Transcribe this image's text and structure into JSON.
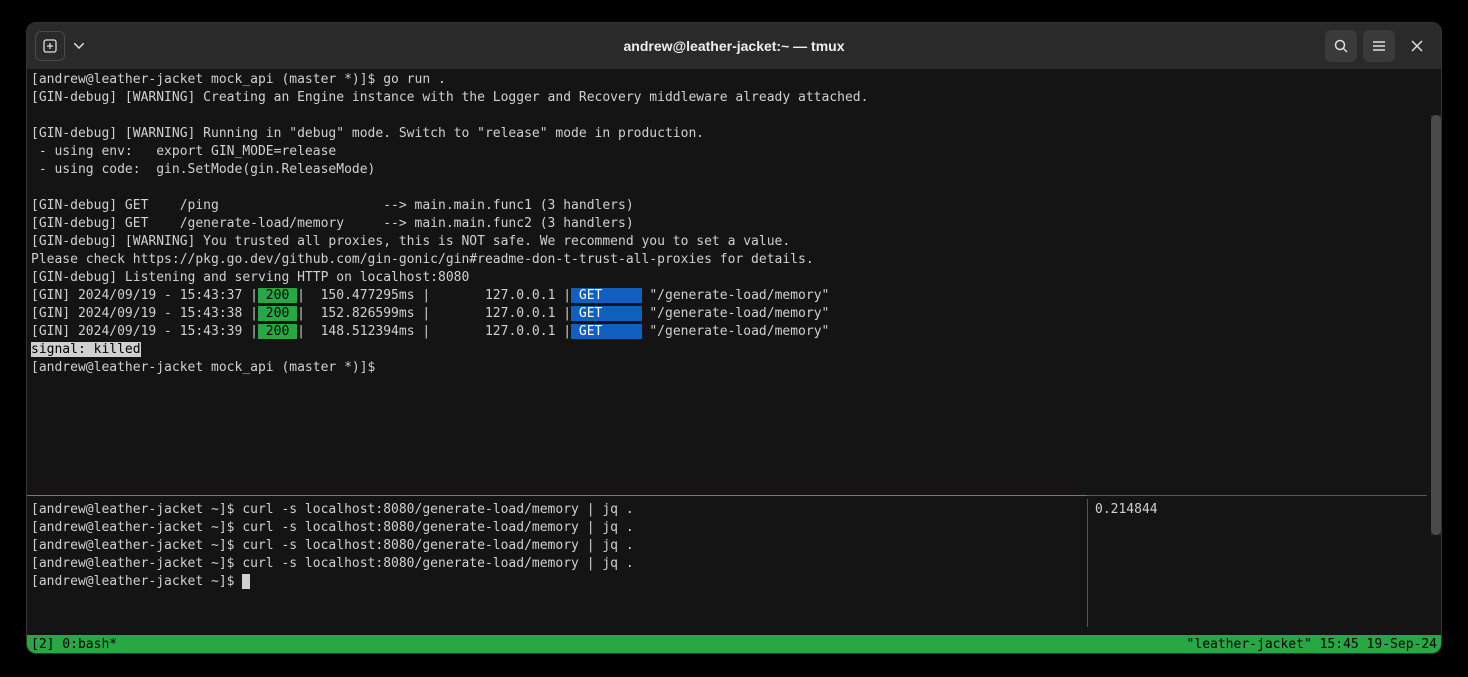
{
  "titlebar": {
    "title": "andrew@leather-jacket:~ — tmux"
  },
  "pane_top": {
    "lines": [
      "[andrew@leather-jacket mock_api (master *)]$ go run .",
      "[GIN-debug] [WARNING] Creating an Engine instance with the Logger and Recovery middleware already attached.",
      "",
      "[GIN-debug] [WARNING] Running in \"debug\" mode. Switch to \"release\" mode in production.",
      " - using env:   export GIN_MODE=release",
      " - using code:  gin.SetMode(gin.ReleaseMode)",
      "",
      "[GIN-debug] GET    /ping                     --> main.main.func1 (3 handlers)",
      "[GIN-debug] GET    /generate-load/memory     --> main.main.func2 (3 handlers)",
      "[GIN-debug] [WARNING] You trusted all proxies, this is NOT safe. We recommend you to set a value.",
      "Please check https://pkg.go.dev/github.com/gin-gonic/gin#readme-don-t-trust-all-proxies for details.",
      "[GIN-debug] Listening and serving HTTP on localhost:8080"
    ],
    "requests": [
      {
        "prefix": "[GIN] 2024/09/19 - 15:43:37 |",
        "status": " 200 ",
        "mid": "|  150.477295ms |       127.0.0.1 |",
        "method": " GET     ",
        "path": " \"/generate-load/memory\""
      },
      {
        "prefix": "[GIN] 2024/09/19 - 15:43:38 |",
        "status": " 200 ",
        "mid": "|  152.826599ms |       127.0.0.1 |",
        "method": " GET     ",
        "path": " \"/generate-load/memory\""
      },
      {
        "prefix": "[GIN] 2024/09/19 - 15:43:39 |",
        "status": " 200 ",
        "mid": "|  148.512394ms |       127.0.0.1 |",
        "method": " GET     ",
        "path": " \"/generate-load/memory\""
      }
    ],
    "signal": "signal: killed",
    "prompt2": "[andrew@leather-jacket mock_api (master *)]$ "
  },
  "pane_bl": {
    "lines": [
      "[andrew@leather-jacket ~]$ curl -s localhost:8080/generate-load/memory | jq .",
      "[andrew@leather-jacket ~]$ curl -s localhost:8080/generate-load/memory | jq .",
      "[andrew@leather-jacket ~]$ curl -s localhost:8080/generate-load/memory | jq .",
      "[andrew@leather-jacket ~]$ curl -s localhost:8080/generate-load/memory | jq ."
    ],
    "prompt": "[andrew@leather-jacket ~]$ "
  },
  "pane_br": {
    "value": "0.214844"
  },
  "statusbar": {
    "left": "[2] 0:bash*",
    "right": "\"leather-jacket\" 15:45 19-Sep-24"
  }
}
